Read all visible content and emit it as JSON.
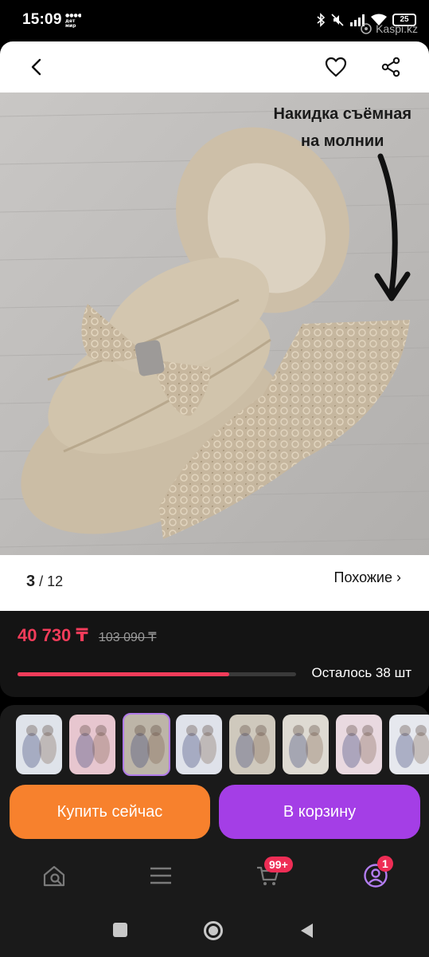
{
  "status_bar": {
    "time": "15:09",
    "dm_label": "дет мир",
    "battery": "25",
    "watermark": "Kaspi.kz"
  },
  "photo": {
    "caption_line1": "Накидка съёмная",
    "caption_line2": "на молнии"
  },
  "gallery": {
    "current": "3",
    "total": "/ 12",
    "similar_label": "Похожие ›"
  },
  "pricing": {
    "price": "40 730 ₸",
    "old_price": "103 090 ₸",
    "stock_fraction": 0.76,
    "remaining_label": "Осталось 38 шт"
  },
  "thumbnails": [
    {
      "name": "thumb-1",
      "bg": "#dfe3ea"
    },
    {
      "name": "thumb-2",
      "bg": "#e7c6cf"
    },
    {
      "name": "thumb-3",
      "bg": "#bdb5a8",
      "active": true
    },
    {
      "name": "thumb-4",
      "bg": "#dfe2ea"
    },
    {
      "name": "thumb-5",
      "bg": "#cfc9bd"
    },
    {
      "name": "thumb-6",
      "bg": "#dedad2"
    },
    {
      "name": "thumb-7",
      "bg": "#e9d9e0"
    },
    {
      "name": "thumb-8",
      "bg": "#e6e8ee"
    }
  ],
  "actions": {
    "buy_now": "Купить сейчас",
    "add_to_cart": "В корзину"
  },
  "bottom_nav": {
    "cart_badge": "99+",
    "profile_badge": "1"
  },
  "colors": {
    "accent_price": "#f23c5a",
    "buy_button": "#f7812d",
    "cart_button": "#a43ee6",
    "active_nav": "#b37df0"
  }
}
